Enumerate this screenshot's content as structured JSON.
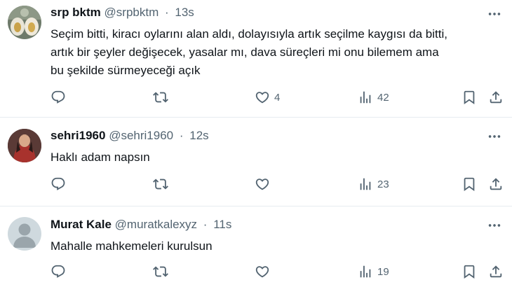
{
  "tweets": [
    {
      "name": "srp bktm",
      "handle": "@srpbktm",
      "separator": "·",
      "time": "13s",
      "text": "Seçim bitti, kiracı oylarını alan aldı, dolayısıyla artık seçilme kaygısı da bitti,\nartık bir şeyler değişecek, yasalar mı, dava süreçleri mi onu bilemem ama\nbu şekilde sürmeyeceği açık",
      "likes": "4",
      "views": "42"
    },
    {
      "name": "sehri1960",
      "handle": "@sehri1960",
      "separator": "·",
      "time": "12s",
      "text": "Haklı adam napsın",
      "likes": "",
      "views": "23"
    },
    {
      "name": "Murat Kale",
      "handle": "@muratkalexyz",
      "separator": "·",
      "time": "11s",
      "text": "Mahalle mahkemeleri kurulsun",
      "likes": "",
      "views": "19"
    }
  ],
  "icons": {
    "more": "more-dots-icon",
    "reply": "reply-icon",
    "retweet": "retweet-icon",
    "like": "like-heart-icon",
    "views": "views-chart-icon",
    "bookmark": "bookmark-icon",
    "share": "share-icon"
  },
  "colors": {
    "text": "#0f1419",
    "secondary": "#536471",
    "divider": "#e6ecf0",
    "default_avatar": "#cfd9de"
  }
}
